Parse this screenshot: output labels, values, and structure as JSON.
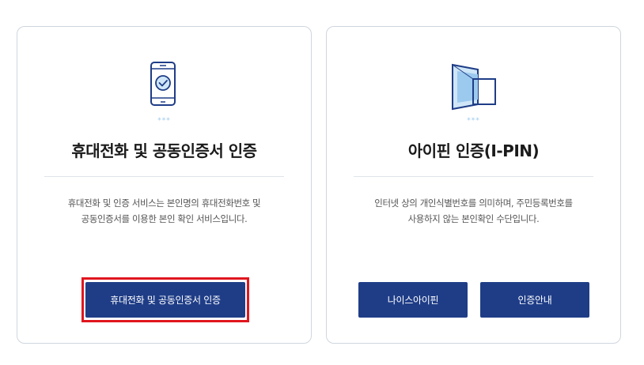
{
  "cards": [
    {
      "icon": "smartphone-check-icon",
      "dots": "***",
      "title": "휴대전화 및 공동인증서 인증",
      "desc_line1": "휴대전화 및 인증 서비스는 본인명의 휴대전화번호 및",
      "desc_line2": "공동인증서를 이용한 본인 확인 서비스입니다.",
      "button_label": "휴대전화 및 공동인증서 인증"
    },
    {
      "icon": "ipin-window-icon",
      "dots": "***",
      "title": "아이핀 인증(I-PIN)",
      "desc_line1": "인터넷 상의 개인식별번호를 의미하며, 주민등록번호를",
      "desc_line2": "사용하지 않는 본인확인 수단입니다.",
      "buttons": [
        "나이스아이핀",
        "인증안내"
      ]
    }
  ],
  "colors": {
    "button": "#1f3d87",
    "highlight": "#e0161e",
    "icon_accent": "#9cc9ee",
    "icon_stroke": "#1f3d87"
  }
}
